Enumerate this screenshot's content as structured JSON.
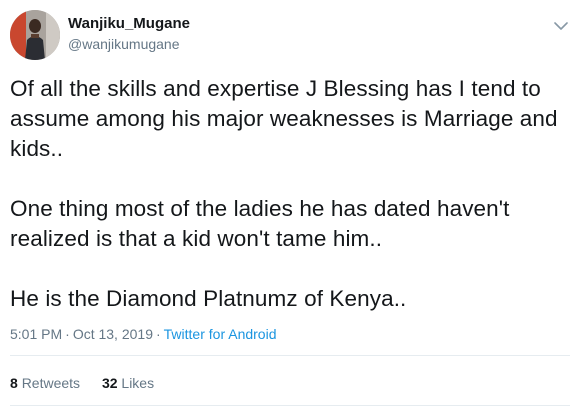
{
  "author": {
    "display_name": "Wanjiku_Mugane",
    "handle": "@wanjikumugane"
  },
  "tweet": {
    "paragraphs": [
      "Of all the skills and expertise J Blessing has I tend to assume among his major weaknesses is Marriage and kids..",
      "One thing most of the ladies he has dated haven't realized is that a kid won't tame him..",
      "He is the Diamond Platnumz of Kenya.."
    ],
    "time": "5:01 PM",
    "date": "Oct 13, 2019",
    "separator": "·",
    "source": "Twitter for Android"
  },
  "stats": {
    "retweets_count": "8",
    "retweets_label": "Retweets",
    "likes_count": "32",
    "likes_label": "Likes"
  },
  "colors": {
    "text": "#14171a",
    "secondary": "#657786",
    "link": "#1b95e0",
    "divider": "#e6ecf0"
  },
  "icons": {
    "menu": "chevron-down-icon"
  }
}
